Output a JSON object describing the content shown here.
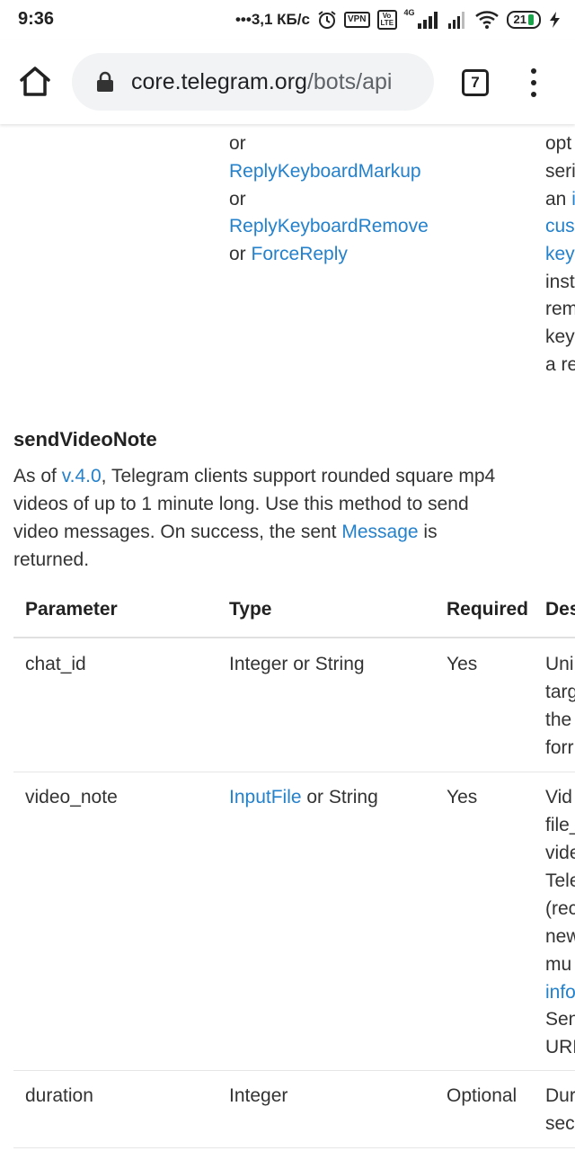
{
  "status_bar": {
    "time": "9:36",
    "network_speed": "•••3,1 КБ/с",
    "vpn_label": "VPN",
    "volte_label": "Vo LTE",
    "net_type": "4G",
    "battery": "21",
    "battery_color": "#1aa34a"
  },
  "browser": {
    "url_host": "core.telegram.org",
    "url_path": "/bots/api",
    "tab_count": "7"
  },
  "prev_table": {
    "type_lines": [
      {
        "kind": "text",
        "value": "or"
      },
      {
        "kind": "link",
        "value": "ReplyKeyboardMarkup"
      },
      {
        "kind": "text",
        "value": "or"
      },
      {
        "kind": "link",
        "value": "ReplyKeyboardRemove"
      }
    ],
    "last_line_prefix": "or ",
    "last_line_link": "ForceReply",
    "description_fragments": [
      "opt",
      "seri",
      "an ",
      "i",
      "cus",
      "key",
      "inst",
      "rem",
      "key",
      "a re"
    ]
  },
  "section": {
    "title": "sendVideoNote",
    "intro_1": "As of ",
    "intro_link_version": "v.4.0",
    "intro_2": ", Telegram clients support rounded square mp4 videos of up to 1 minute long. Use this method to send video messages. On success, the sent ",
    "intro_link_message": "Message",
    "intro_3": " is returned."
  },
  "table": {
    "headers": [
      "Parameter",
      "Type",
      "Required",
      "Des"
    ],
    "rows": [
      {
        "parameter": "chat_id",
        "type": "Integer or String",
        "required": "Yes",
        "description_fragments": [
          "Uni",
          "targ",
          "the",
          "forr"
        ]
      },
      {
        "parameter": "video_note",
        "type_link": "InputFile",
        "type_rest": " or String",
        "required": "Yes",
        "description_fragments": [
          "Vid",
          "file_",
          "vide",
          "Tele",
          "(rec",
          "new",
          "mu",
          "info",
          "Sen",
          "URL"
        ]
      },
      {
        "parameter": "duration",
        "type": "Integer",
        "required": "Optional",
        "description_fragments": [
          "Dur",
          "sec"
        ]
      }
    ]
  }
}
